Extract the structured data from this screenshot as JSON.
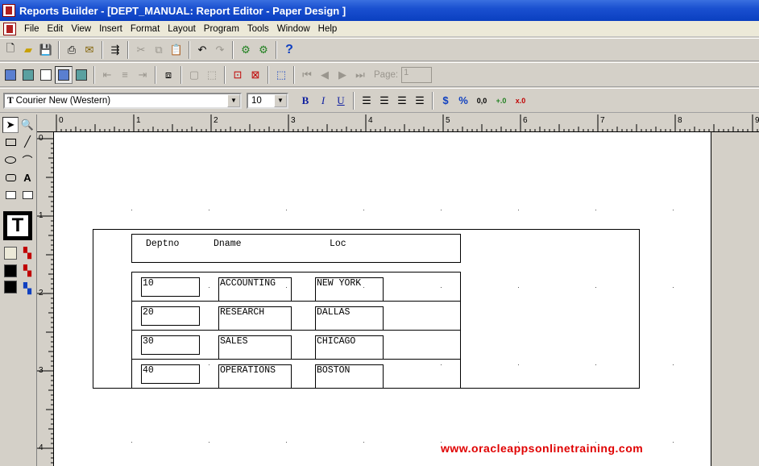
{
  "window": {
    "title": "Reports Builder - [DEPT_MANUAL: Report Editor - Paper Design ]"
  },
  "menu": [
    "File",
    "Edit",
    "View",
    "Insert",
    "Format",
    "Layout",
    "Program",
    "Tools",
    "Window",
    "Help"
  ],
  "toolbar": {
    "font_name": "Courier New (Western)",
    "font_size": "10",
    "bold": "B",
    "italic": "I",
    "underline": "U",
    "currency": "$",
    "percent": "%",
    "comma": "0,0",
    "add_decimal": "+.0",
    "remove_decimal": "x.0",
    "help": "?",
    "page_label": "Page:",
    "page_value": "1"
  },
  "ruler": {
    "h_labels": [
      "0",
      "1",
      "2",
      "3",
      "4",
      "5",
      "6",
      "7",
      "8",
      "9"
    ],
    "v_labels": [
      "0",
      "1",
      "2",
      "3",
      "4"
    ]
  },
  "report": {
    "headers": {
      "deptno": "Deptno",
      "dname": "Dname",
      "loc": "Loc"
    },
    "rows": [
      {
        "deptno": "10",
        "dname": "ACCOUNTING",
        "loc": "NEW YORK"
      },
      {
        "deptno": "20",
        "dname": "RESEARCH",
        "loc": "DALLAS"
      },
      {
        "deptno": "30",
        "dname": "SALES",
        "loc": "CHICAGO"
      },
      {
        "deptno": "40",
        "dname": "OPERATIONS",
        "loc": "BOSTON"
      }
    ]
  },
  "watermark": "www.oracleappsonlinetraining.com",
  "colors": {
    "titlebar": "#0a3fc0",
    "watermark": "#e00000",
    "face": "#d4d0c8"
  }
}
